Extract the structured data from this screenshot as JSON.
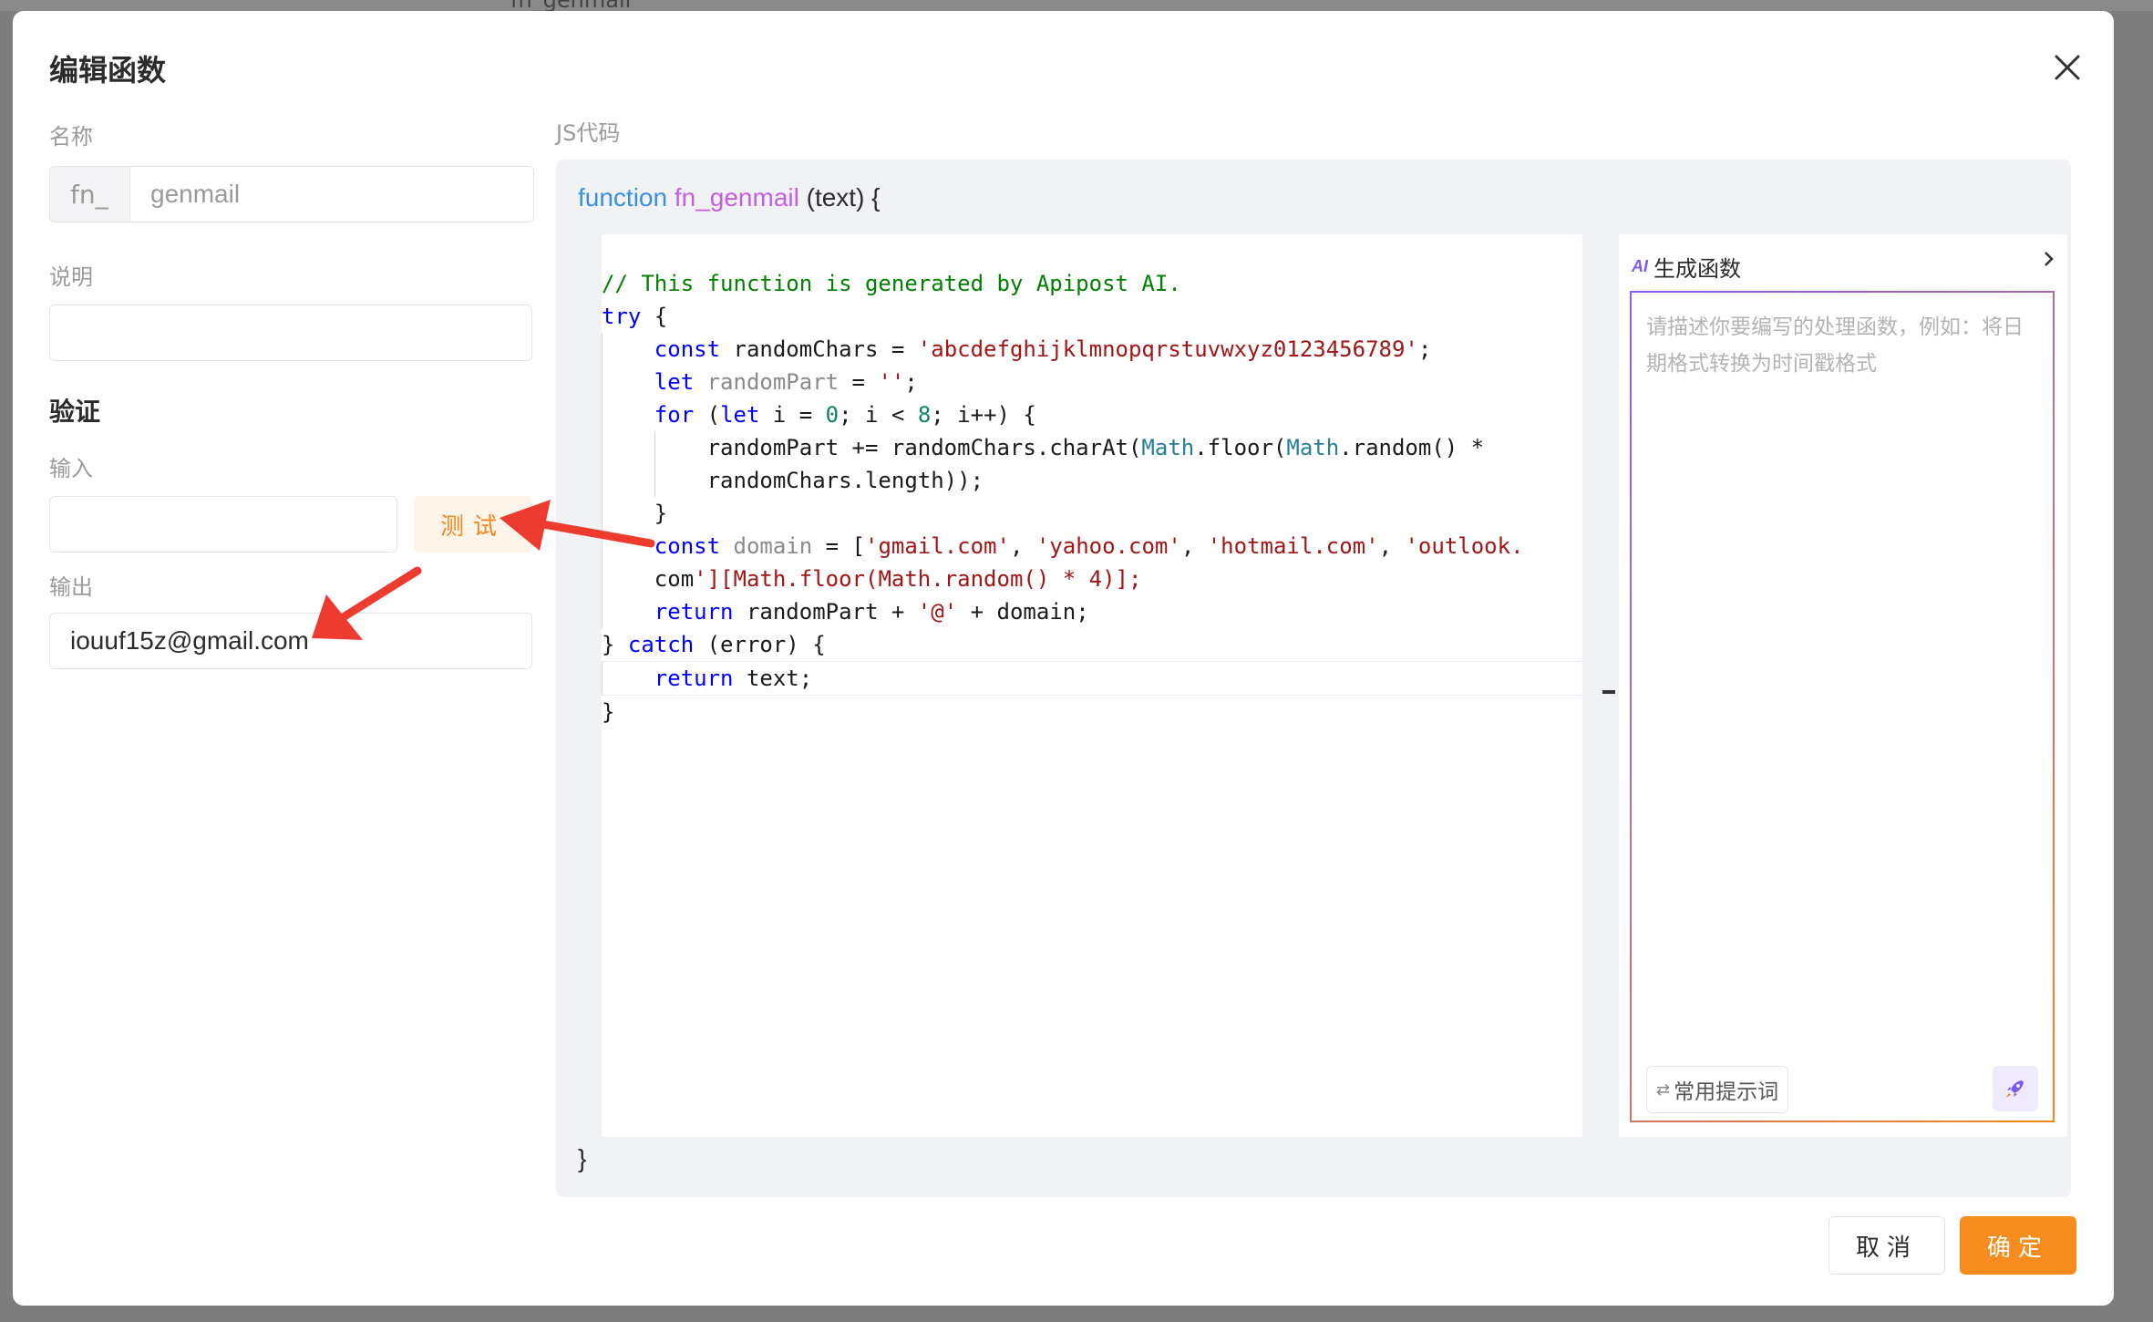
{
  "background": {
    "partial_text": "fn_genmail"
  },
  "dialog": {
    "title": "编辑函数",
    "close_icon": "close-icon"
  },
  "form": {
    "name_label": "名称",
    "name_prefix": "fn_",
    "name_value": "genmail",
    "description_label": "说明",
    "description_value": "",
    "verify_title": "验证",
    "input_label": "输入",
    "input_value": "",
    "test_button": "测试",
    "output_label": "输出",
    "output_value": "iouuf15z@gmail.com"
  },
  "code": {
    "label": "JS代码",
    "signature_keyword": "function",
    "signature_name": "fn_genmail",
    "signature_params": " (text) {",
    "closing_brace": "}",
    "lines": [
      "// This function is generated by Apipost AI.",
      "try {",
      "    const randomChars = 'abcdefghijklmnopqrstuvwxyz0123456789';",
      "    let randomPart = '';",
      "    for (let i = 0; i < 8; i++) {",
      "        randomPart += randomChars.charAt(Math.floor(Math.random() *",
      "        randomChars.length));",
      "    }",
      "    const domain = ['gmail.com', 'yahoo.com', 'hotmail.com', 'outlook.",
      "    com'][Math.floor(Math.random() * 4)];",
      "    return randomPart + '@' + domain;",
      "} catch (error) {",
      "    return text;",
      "}"
    ]
  },
  "ai": {
    "badge": "AI",
    "title": "生成函数",
    "expand_icon": "chevron-right-icon",
    "placeholder": "请描述你要编写的处理函数，例如：将日期格式转换为时间戳格式",
    "prompts_button": "常用提示词",
    "send_icon": "rocket-icon"
  },
  "footer": {
    "cancel": "取消",
    "confirm": "确定"
  },
  "colors": {
    "accent": "#f68b1e",
    "annotation_arrow": "#ee3b2f",
    "ai_purple": "#7b5cf0"
  }
}
